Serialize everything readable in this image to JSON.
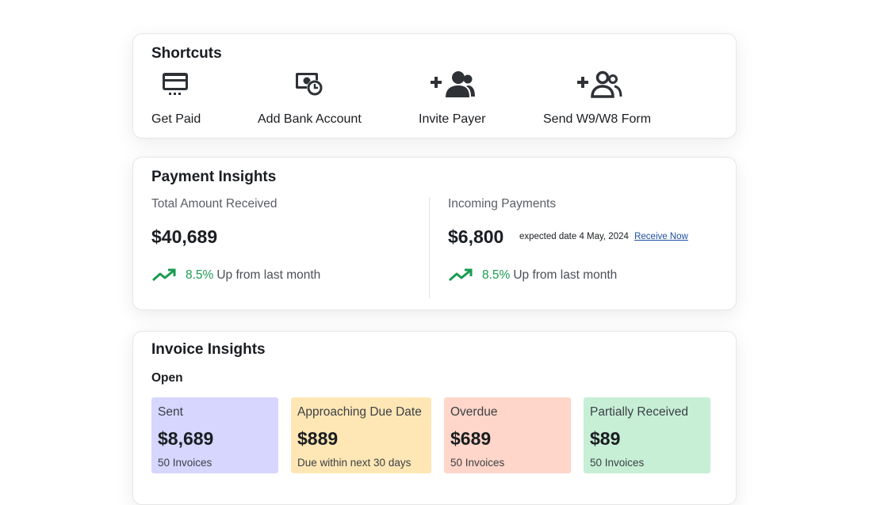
{
  "shortcuts": {
    "title": "Shortcuts",
    "items": [
      {
        "label": "Get Paid",
        "icon": "credit-card-icon"
      },
      {
        "label": "Add Bank Account",
        "icon": "bank-clock-icon"
      },
      {
        "label": "Invite Payer",
        "icon": "add-users-icon"
      },
      {
        "label": "Send W9/W8 Form",
        "icon": "add-users-outline-icon"
      }
    ]
  },
  "payment_insights": {
    "title": "Payment Insights",
    "received": {
      "label": "Total Amount Received",
      "amount": "$40,689",
      "trend_pct": "8.5%",
      "trend_text": "Up from last month"
    },
    "incoming": {
      "label": "Incoming Payments",
      "amount": "$6,800",
      "expected": "expected date 4 May, 2024",
      "link": "Receive Now",
      "trend_pct": "8.5%",
      "trend_text": "Up from last month"
    },
    "colors": {
      "trend": "#1a9b52",
      "link": "#1d4fa0"
    }
  },
  "invoice_insights": {
    "title": "Invoice Insights",
    "open_label": "Open",
    "tiles": [
      {
        "title": "Sent",
        "amount": "$8,689",
        "sub": "50 Invoices",
        "color": "#d6d6ff"
      },
      {
        "title": "Approaching Due Date",
        "amount": "$889",
        "sub": "Due within next 30 days",
        "color": "#ffe7b5"
      },
      {
        "title": "Overdue",
        "amount": "$689",
        "sub": "50 Invoices",
        "color": "#ffd6c9"
      },
      {
        "title": "Partially Received",
        "amount": "$89",
        "sub": "50 Invoices",
        "color": "#c6efd6"
      }
    ]
  }
}
